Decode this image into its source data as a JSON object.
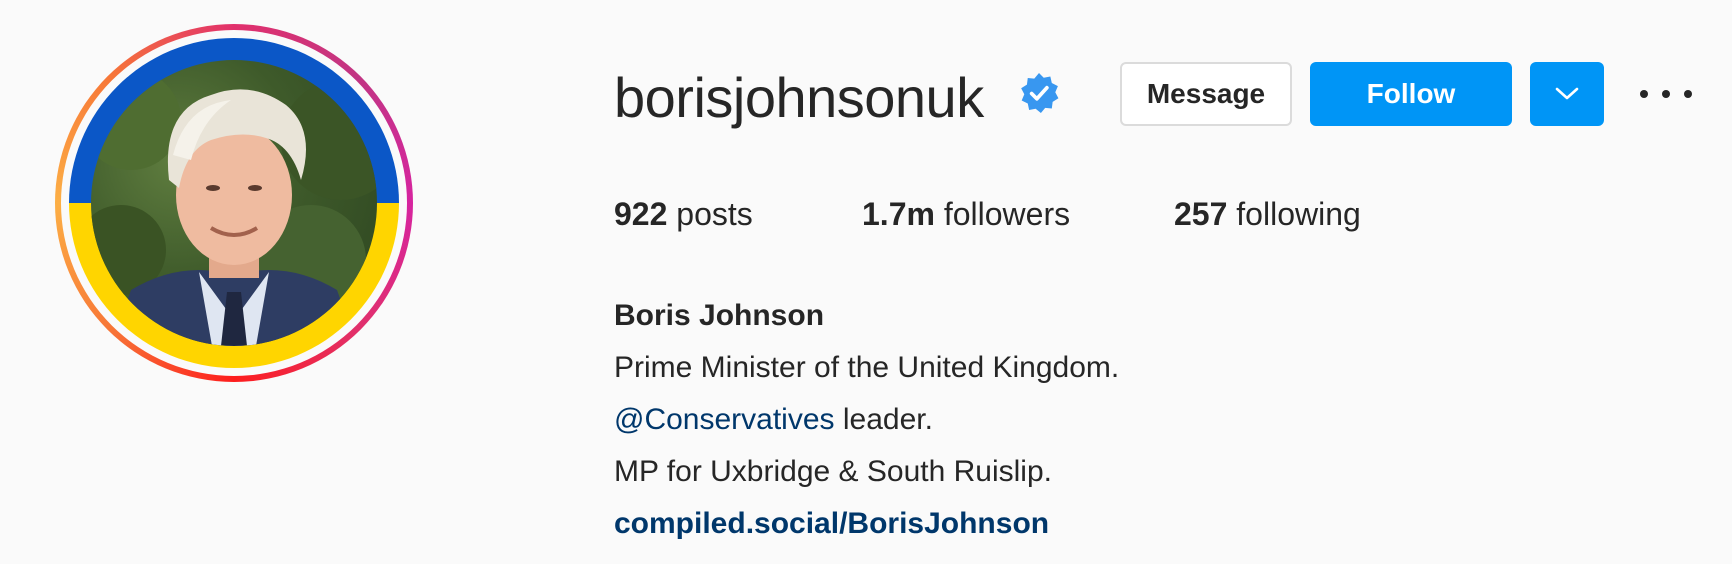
{
  "profile": {
    "username": "borisjohnsonuk",
    "verified": true,
    "buttons": {
      "message": "Message",
      "follow": "Follow"
    },
    "stats": {
      "posts_count": "922",
      "posts_label": "posts",
      "followers_count": "1.7m",
      "followers_label": "followers",
      "following_count": "257",
      "following_label": "following"
    },
    "bio": {
      "name": "Boris Johnson",
      "line1": "Prime Minister of the United Kingdom.",
      "mention": "@Conservatives",
      "line2_rest": " leader.",
      "line3": "MP for Uxbridge & South Ruislip.",
      "link": "compiled.social/BorisJohnson"
    }
  },
  "colors": {
    "accent": "#0095f6",
    "link": "#00376b",
    "verified": "#3897f0",
    "flag_blue": "#0b57c7",
    "flag_yellow": "#ffd500"
  },
  "icons": {
    "verified": "verified-badge-icon",
    "dropdown": "chevron-down-icon",
    "more": "more-options-icon"
  }
}
